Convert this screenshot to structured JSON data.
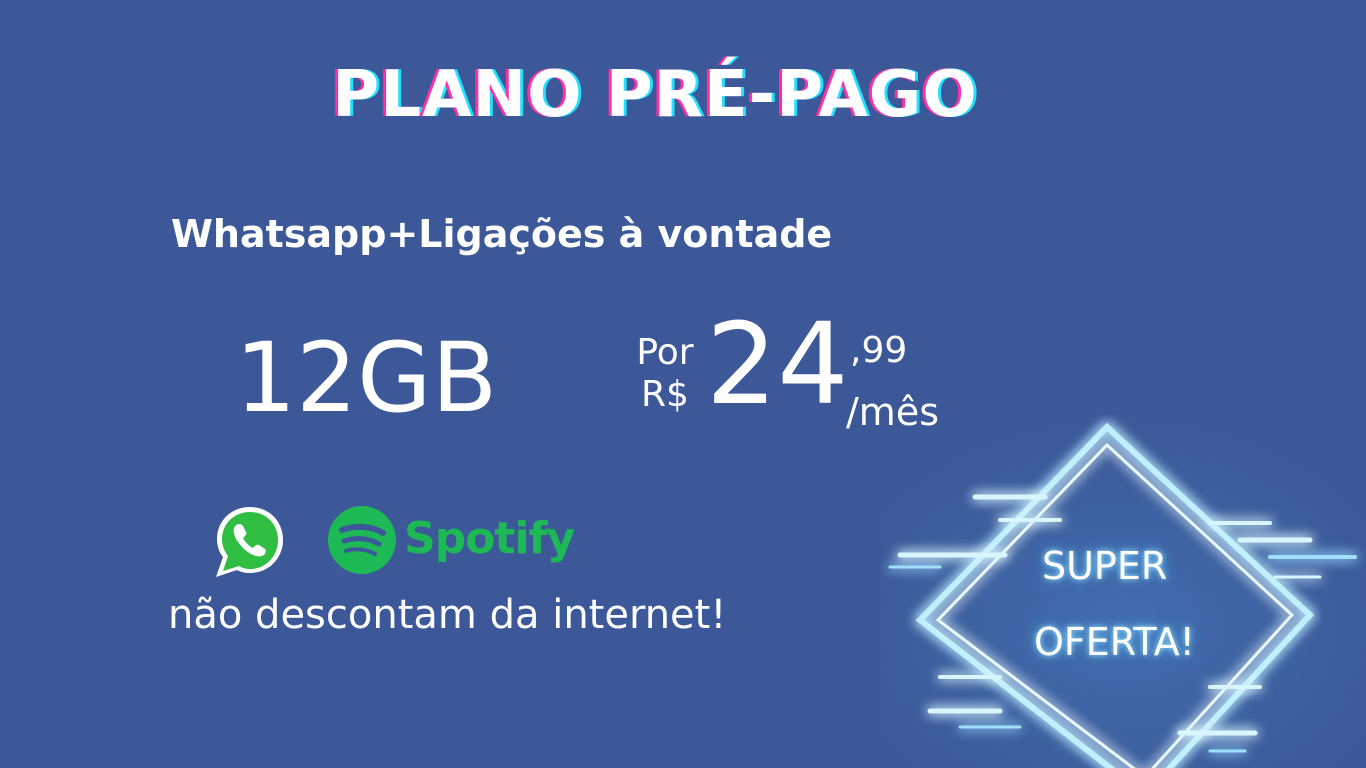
{
  "title": "PLANO PRÉ-PAGO",
  "subtitle": "Whatsapp+Ligações à vontade",
  "data_amount": "12GB",
  "price": {
    "prefix_line1": "Por",
    "prefix_line2": "R$",
    "integer": "24",
    "cents": ",99",
    "period": "/mês"
  },
  "logos": {
    "whatsapp": "whatsapp-logo",
    "spotify_wordmark": "Spotify",
    "spotify_registered": "®"
  },
  "footnote": "não descontam da internet!",
  "badge": {
    "line1": "SUPER",
    "line2": "OFERTA!"
  },
  "colors": {
    "background": "#3c5899",
    "text": "#ffffff",
    "spotify_green": "#1db954",
    "whatsapp_green": "#2fbe42",
    "neon_blue": "#5ac8ff"
  }
}
